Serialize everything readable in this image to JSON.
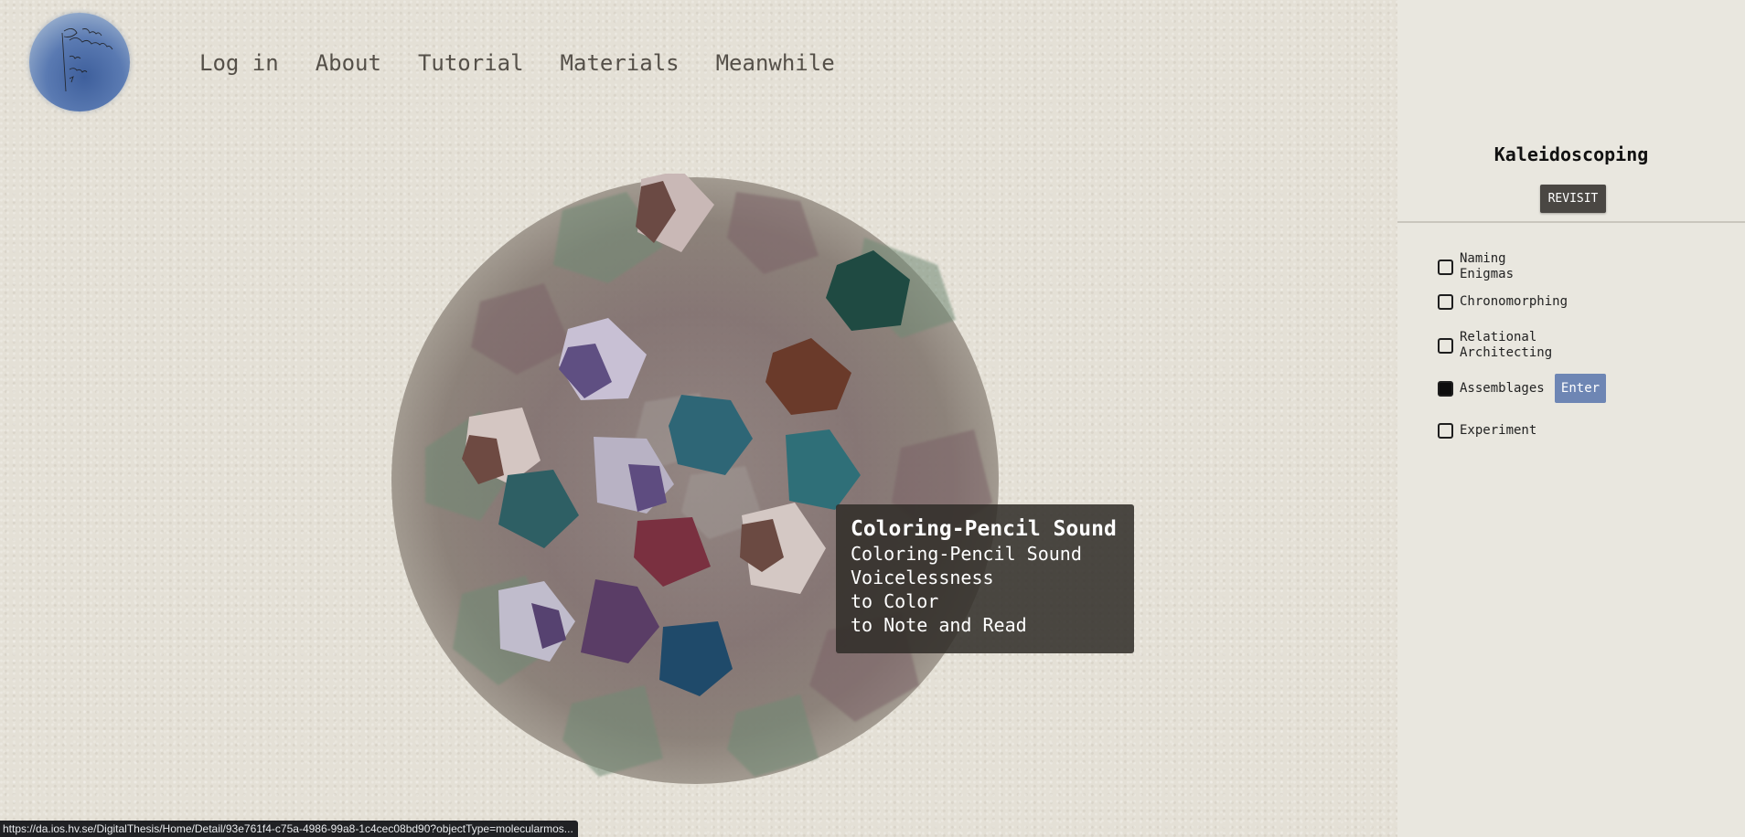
{
  "nav": {
    "items": [
      "Log in",
      "About",
      "Tutorial",
      "Materials",
      "Meanwhile"
    ]
  },
  "tooltip": {
    "title": "Coloring-Pencil Sound",
    "lines": [
      "Coloring-Pencil Sound",
      "Voicelessness",
      "to Color",
      "to Note and Read"
    ]
  },
  "sidebar": {
    "title": "Kaleidoscoping",
    "revisit_label": "REVISIT",
    "options": [
      {
        "label": "Naming Enigmas",
        "checked": false
      },
      {
        "label": "Chronomorphing",
        "checked": false
      },
      {
        "label": "Relational Architecting",
        "checked": false
      },
      {
        "label": "Assemblages",
        "checked": true
      },
      {
        "label": "Experiment",
        "checked": false
      }
    ],
    "enter_label": "Enter"
  },
  "status_bar": {
    "url": "https://da.ios.hv.se/DigitalThesis/Home/Detail/93e761f4-c75a-4986-99a8-1c4cec08bd90?objectType=molecularmos..."
  },
  "colors": {
    "paper": "#e4e0d6",
    "sidebar": "#e9e7df",
    "logo_blue": "#4a6aa4",
    "enter_button": "#6e86b4",
    "revisit_button": "#4a4743",
    "tooltip_bg": "#302c28"
  }
}
